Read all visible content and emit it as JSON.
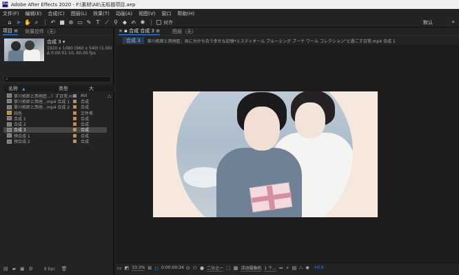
{
  "titlebar": {
    "app_icon_text": "Ae",
    "title": "Adobe After Effects 2020 - F:\\素材\\AE\\无标题项目.aep"
  },
  "menu": [
    "文件(F)",
    "编辑(E)",
    "合成(C)",
    "图层(L)",
    "效果(T)",
    "动画(A)",
    "视图(V)",
    "窗口",
    "帮助(H)"
  ],
  "toolbar": {
    "tools": [
      "home-icon",
      "selection-arrow-icon",
      "hand-icon",
      "zoom-icon",
      "rotate-icon",
      "camera-icon",
      "pan-behind-icon",
      "rectangle-icon",
      "pen-icon",
      "text-icon",
      "brush-icon",
      "clone-stamp-icon",
      "eraser-icon",
      "roto-brush-icon",
      "puppet-pin-icon"
    ],
    "snap_label": "对齐",
    "workspace": "默认",
    "workspace_more": "»"
  },
  "project_panel": {
    "tab_project": "项目",
    "tab_menu": "≡",
    "tab_effects": "效果控件（无）",
    "comp_name": "合成 3 ▾",
    "comp_size": "1920 x 1080 (960 x 540) (1.00)",
    "comp_duration": "Δ 0:00:01:10, 60.00 fps",
    "columns": {
      "name": "名称",
      "type": "类型",
      "size": "大"
    },
    "items": [
      {
        "name": "草川拓郎と西垣匠…〉ず日常.mp4",
        "type": "AVI",
        "icon": "video",
        "label": "purple",
        "selected": false
      },
      {
        "name": "草川拓郎と西垣…mp4 合成 1",
        "type": "合成",
        "icon": "comp",
        "label": "tan",
        "selected": false
      },
      {
        "name": "草川拓郎と西垣…mp4 合成 2",
        "type": "合成",
        "icon": "comp",
        "label": "tan",
        "selected": false
      },
      {
        "name": "纯色",
        "type": "文件夹",
        "icon": "folder",
        "label": "tan",
        "selected": false
      },
      {
        "name": "合成 1",
        "type": "合成",
        "icon": "comp",
        "label": "tan",
        "selected": false
      },
      {
        "name": "合成 2",
        "type": "合成",
        "icon": "comp",
        "label": "tan",
        "selected": false
      },
      {
        "name": "合成 3",
        "type": "合成",
        "icon": "comp",
        "label": "tan",
        "selected": true
      },
      {
        "name": "预合成 1",
        "type": "合成",
        "icon": "comp",
        "label": "tan",
        "selected": false
      },
      {
        "name": "预合成 2",
        "type": "合成",
        "icon": "comp",
        "label": "tan",
        "selected": false
      }
    ],
    "bpc": "8 bpc"
  },
  "comp_panel": {
    "tab_close": "×",
    "tab_comp": "合成 合成 3",
    "tab_menu": "≡",
    "tab_layer": "图层（无）",
    "crumb_active": "合成 3",
    "crumb_path": "草川拓郎と西垣匠、共に分かち合う幸せな記憶*ミスディオール ブルーミング ブーケ ワール コレクション\"と過ごす日常.mp4 合成 1"
  },
  "viewer_footer": {
    "zoom": "33.3%",
    "timecode": "0:00:00:34",
    "resolution": "二分之一",
    "camera": "活动摄像机",
    "views": "1 个...",
    "exposure": "+0.0"
  }
}
